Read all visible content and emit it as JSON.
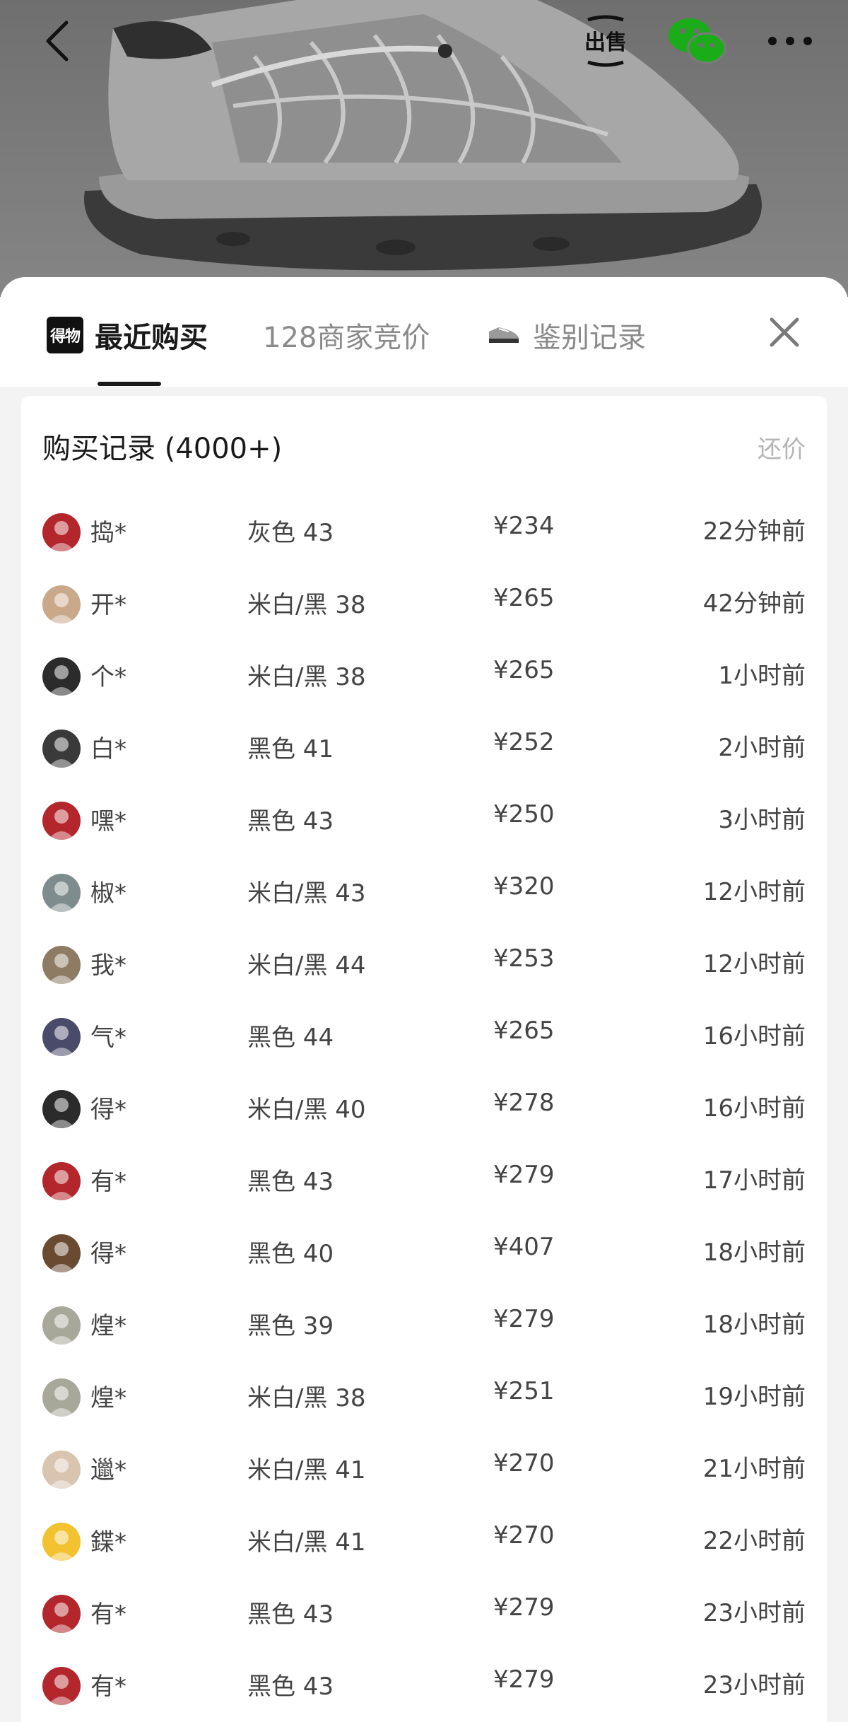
{
  "tabs": {
    "recent": "最近购买",
    "bid": "128商家竞价",
    "auth": "鉴别记录",
    "logo_text": "得物"
  },
  "header": {
    "sell_label": "出售"
  },
  "records": {
    "title": "购买记录 (4000+)",
    "bargain_label": "还价",
    "rows": [
      {
        "name": "捣*",
        "spec": "灰色 43",
        "price": "¥234",
        "time": "22分钟前",
        "avatar": "#b3262c"
      },
      {
        "name": "开*",
        "spec": "米白/黑 38",
        "price": "¥265",
        "time": "42分钟前",
        "avatar": "#c9a98a"
      },
      {
        "name": "个*",
        "spec": "米白/黑 38",
        "price": "¥265",
        "time": "1小时前",
        "avatar": "#2b2b2b"
      },
      {
        "name": "白*",
        "spec": "黑色 41",
        "price": "¥252",
        "time": "2小时前",
        "avatar": "#3a3a3a"
      },
      {
        "name": "嘿*",
        "spec": "黑色 43",
        "price": "¥250",
        "time": "3小时前",
        "avatar": "#b3262c"
      },
      {
        "name": "椒*",
        "spec": "米白/黑 43",
        "price": "¥320",
        "time": "12小时前",
        "avatar": "#7f8c8d"
      },
      {
        "name": "我*",
        "spec": "米白/黑 44",
        "price": "¥253",
        "time": "12小时前",
        "avatar": "#8d7b63"
      },
      {
        "name": "气*",
        "spec": "黑色 44",
        "price": "¥265",
        "time": "16小时前",
        "avatar": "#4a4a6a"
      },
      {
        "name": "得*",
        "spec": "米白/黑 40",
        "price": "¥278",
        "time": "16小时前",
        "avatar": "#2b2b2b"
      },
      {
        "name": "有*",
        "spec": "黑色 43",
        "price": "¥279",
        "time": "17小时前",
        "avatar": "#b3262c"
      },
      {
        "name": "得*",
        "spec": "黑色 40",
        "price": "¥407",
        "time": "18小时前",
        "avatar": "#6b4a32"
      },
      {
        "name": "煌*",
        "spec": "黑色 39",
        "price": "¥279",
        "time": "18小时前",
        "avatar": "#a8a89a"
      },
      {
        "name": "煌*",
        "spec": "米白/黑 38",
        "price": "¥251",
        "time": "19小时前",
        "avatar": "#a8a89a"
      },
      {
        "name": "邋*",
        "spec": "米白/黑 41",
        "price": "¥270",
        "time": "21小时前",
        "avatar": "#d9c4b0"
      },
      {
        "name": "鍱*",
        "spec": "米白/黑 41",
        "price": "¥270",
        "time": "22小时前",
        "avatar": "#f2c230"
      },
      {
        "name": "有*",
        "spec": "黑色 43",
        "price": "¥279",
        "time": "23小时前",
        "avatar": "#b3262c"
      },
      {
        "name": "有*",
        "spec": "黑色 43",
        "price": "¥279",
        "time": "23小时前",
        "avatar": "#b3262c"
      }
    ]
  }
}
